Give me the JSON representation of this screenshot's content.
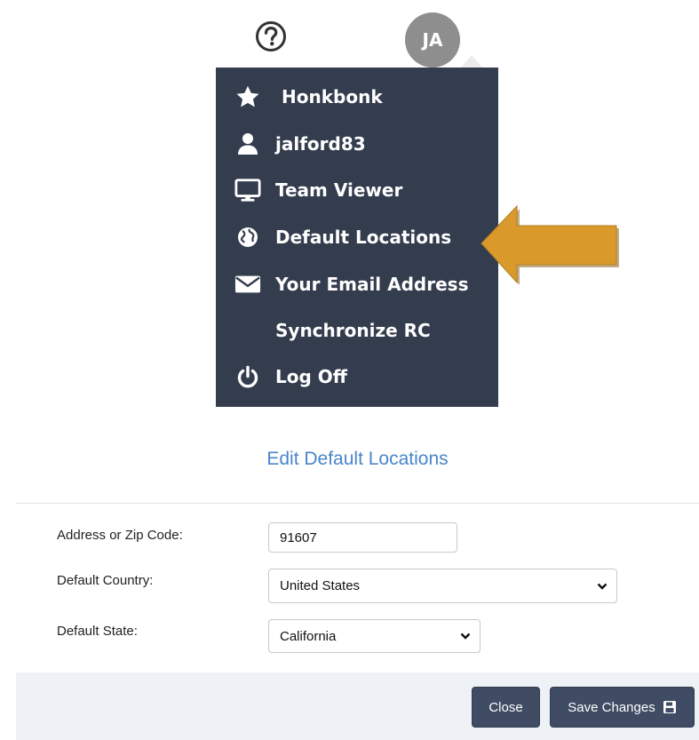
{
  "topbar": {
    "help_icon": "question-circle-icon",
    "avatar_initials": "JA"
  },
  "menu": {
    "items": [
      {
        "label": "Honkbonk",
        "icon": "star-icon"
      },
      {
        "label": "jalford83",
        "icon": "user-icon"
      },
      {
        "label": "Team Viewer",
        "icon": "monitor-icon"
      },
      {
        "label": "Default Locations",
        "icon": "globe-icon"
      },
      {
        "label": "Your Email Address",
        "icon": "envelope-icon"
      },
      {
        "label": "Synchronize RC",
        "icon": ""
      },
      {
        "label": "Log Off",
        "icon": "power-icon"
      }
    ]
  },
  "annotation": {
    "arrow_color": "#d99a2b",
    "icon": "arrow-left-icon"
  },
  "dialog": {
    "title": "Edit Default Locations",
    "fields": {
      "address": {
        "label": "Address or Zip Code:",
        "value": "91607"
      },
      "country": {
        "label": "Default Country:",
        "value": "United States"
      },
      "state": {
        "label": "Default State:",
        "value": "California"
      }
    },
    "buttons": {
      "close": "Close",
      "save": "Save Changes"
    }
  },
  "colors": {
    "menu_bg": "#343d4e",
    "accent_title": "#4a86c8",
    "button_bg": "#3f4c63",
    "footer_bg": "#eef1f6"
  }
}
